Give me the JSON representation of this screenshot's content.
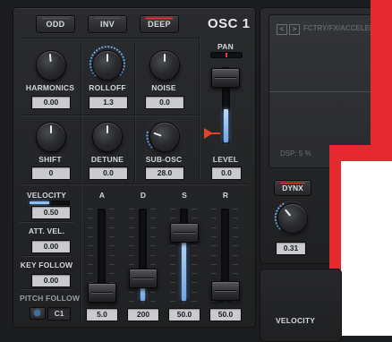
{
  "osc": {
    "title": "OSC 1",
    "buttons": [
      {
        "label": "ODD",
        "active": false
      },
      {
        "label": "INV",
        "active": false
      },
      {
        "label": "DEEP",
        "active": true
      }
    ]
  },
  "knobs": {
    "harmonics": {
      "label": "HARMONICS",
      "value": "0.00"
    },
    "rolloff": {
      "label": "ROLLOFF",
      "value": "1.3"
    },
    "noise": {
      "label": "NOISE",
      "value": "0.0"
    },
    "shift": {
      "label": "SHIFT",
      "value": "0"
    },
    "detune": {
      "label": "DETUNE",
      "value": "0.0"
    },
    "sub_osc": {
      "label": "SUB-OSC",
      "value": "28.0"
    }
  },
  "pan": {
    "label": "PAN"
  },
  "level": {
    "label": "LEVEL",
    "value": "0.0",
    "fill_fraction": 0.45
  },
  "left_column": {
    "velocity": {
      "label": "VELOCITY",
      "value": "0.50"
    },
    "att_vel": {
      "label": "ATT. VEL.",
      "value": "0.00"
    },
    "key_follow": {
      "label": "KEY FOLLOW",
      "value": "0.00"
    },
    "pitch_follow": {
      "label": "PITCH FOLLOW",
      "value": "C1"
    }
  },
  "adsr": [
    {
      "label": "A",
      "value": "5.0",
      "level": 0.1
    },
    {
      "label": "D",
      "value": "200",
      "level": 0.25
    },
    {
      "label": "S",
      "value": "50.0",
      "level": 0.75
    },
    {
      "label": "R",
      "value": "50.0",
      "level": 0.12
    }
  ],
  "right": {
    "nav_prev": "<",
    "nav_next": ">",
    "preset_path": "FCTRY/FX/ACCELERATOR",
    "dsp": "DSP: 5 %",
    "dynx_label": "DYNX",
    "dynx_value": "0.31",
    "velocity_label": "VELOCITY"
  },
  "colors": {
    "accent_blue": "#6fa6e0",
    "accent_red": "#e0442a",
    "overlay_red": "#e42a2f"
  }
}
